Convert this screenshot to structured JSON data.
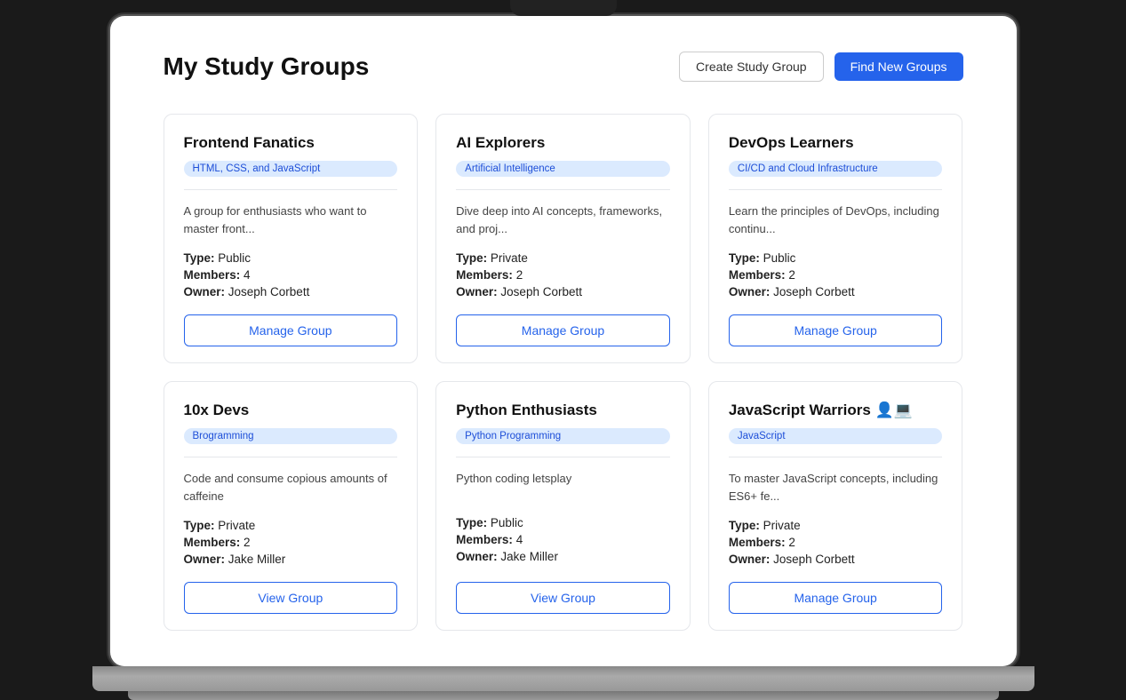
{
  "page": {
    "title": "My Study Groups",
    "actions": {
      "create_label": "Create Study Group",
      "find_label": "Find New Groups"
    }
  },
  "groups": [
    {
      "id": "frontend-fanatics",
      "name": "Frontend Fanatics",
      "tag": "HTML, CSS, and JavaScript",
      "description": "A group for enthusiasts who want to master front...",
      "type": "Public",
      "members": 4,
      "owner": "Joseph Corbett",
      "button_label": "Manage Group",
      "button_type": "manage"
    },
    {
      "id": "ai-explorers",
      "name": "AI Explorers",
      "tag": "Artificial Intelligence",
      "description": "Dive deep into AI concepts, frameworks, and proj...",
      "type": "Private",
      "members": 2,
      "owner": "Joseph Corbett",
      "button_label": "Manage Group",
      "button_type": "manage"
    },
    {
      "id": "devops-learners",
      "name": "DevOps Learners",
      "tag": "CI/CD and Cloud Infrastructure",
      "description": "Learn the principles of DevOps, including continu...",
      "type": "Public",
      "members": 2,
      "owner": "Joseph Corbett",
      "button_label": "Manage Group",
      "button_type": "manage"
    },
    {
      "id": "10x-devs",
      "name": "10x Devs",
      "tag": "Brogramming",
      "description": "Code and consume copious amounts of caffeine",
      "type": "Private",
      "members": 2,
      "owner": "Jake Miller",
      "button_label": "View Group",
      "button_type": "view"
    },
    {
      "id": "python-enthusiasts",
      "name": "Python Enthusiasts",
      "tag": "Python Programming",
      "description": "Python coding letsplay",
      "type": "Public",
      "members": 4,
      "owner": "Jake Miller",
      "button_label": "View Group",
      "button_type": "view"
    },
    {
      "id": "javascript-warriors",
      "name": "JavaScript Warriors 👤💻",
      "tag": "JavaScript",
      "description": "To master JavaScript concepts, including ES6+ fe...",
      "type": "Private",
      "members": 2,
      "owner": "Joseph Corbett",
      "button_label": "Manage Group",
      "button_type": "manage"
    }
  ],
  "labels": {
    "type": "Type:",
    "members": "Members:",
    "owner": "Owner:"
  }
}
